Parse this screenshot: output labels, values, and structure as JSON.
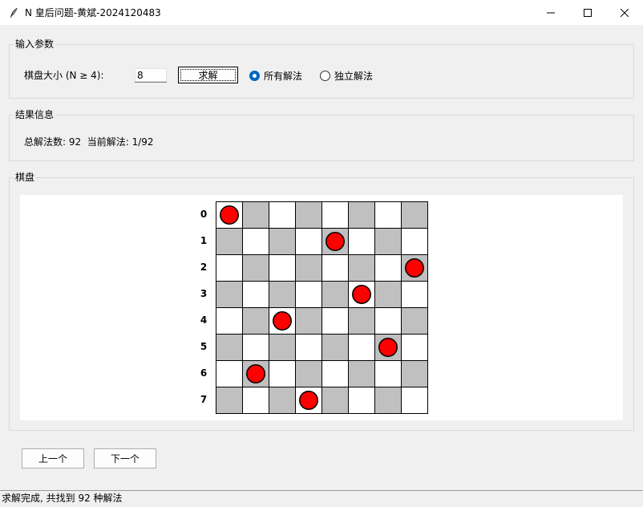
{
  "window": {
    "title": "N 皇后问题-黄斌-2024120483"
  },
  "input_group": {
    "label": "输入参数",
    "size_label": "棋盘大小 (N ≥ 4):",
    "size_value": "8",
    "solve_label": "求解",
    "radio_all_label": "所有解法",
    "radio_unique_label": "独立解法",
    "selected_mode": "all"
  },
  "result_group": {
    "label": "结果信息",
    "summary_text": "总解法数: 92  当前解法: 1/92"
  },
  "board_group": {
    "label": "棋盘",
    "n": 8,
    "row_labels": [
      "0",
      "1",
      "2",
      "3",
      "4",
      "5",
      "6",
      "7"
    ],
    "queen_columns": [
      0,
      4,
      7,
      5,
      2,
      6,
      1,
      3
    ],
    "colors": {
      "light": "#ffffff",
      "dark": "#c0c0c0",
      "queen": "#ff0000",
      "queen_outline": "#000000"
    }
  },
  "nav": {
    "prev_label": "上一个",
    "next_label": "下一个"
  },
  "status": {
    "text": "求解完成, 共找到 92 种解法"
  }
}
